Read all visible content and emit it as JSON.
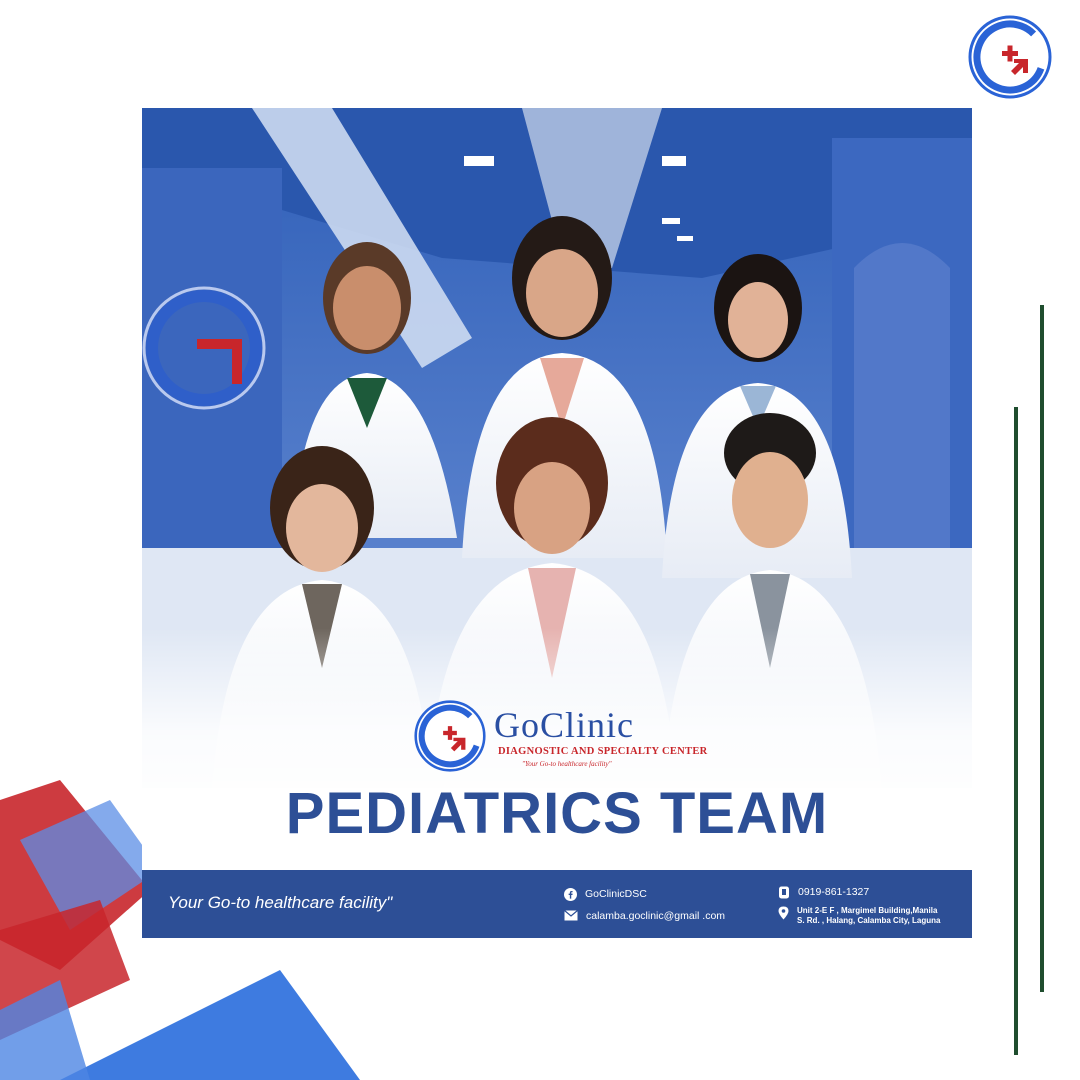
{
  "brand": {
    "name": "GoClinic",
    "subtitle": "DIAGNOSTIC AND SPECIALTY CENTER",
    "tagline": "\"Your Go-to healthcare facility\""
  },
  "headline": "PEDIATRICS TEAM",
  "footer": {
    "tagline": "Your Go-to healthcare facility\"",
    "facebook": "GoClinicDSC",
    "email": "calamba.goclinic@gmail .com",
    "phone": "0919-861-1327",
    "address": "Unit 2-E F , Margimel Building,Manila S. Rd. , Halang, Calamba City, Laguna"
  },
  "icons": [
    "goclinic-logo",
    "facebook-icon",
    "mail-icon",
    "phone-icon",
    "location-pin-icon"
  ],
  "colors": {
    "brand_blue": "#2d4f96",
    "brand_red": "#c8262b",
    "accent_green": "#1f4d2e"
  }
}
